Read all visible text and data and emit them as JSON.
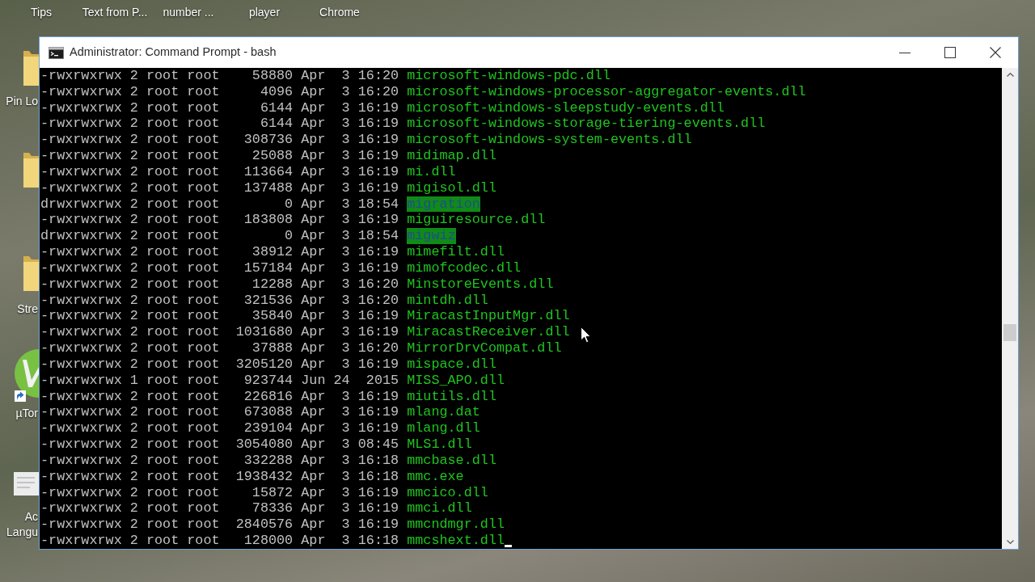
{
  "desktop": {
    "top_labels": [
      "Tips",
      "Text from P...",
      "number ...",
      "player",
      "Chrome"
    ],
    "side_icons": [
      {
        "kind": "folder",
        "label_lines": [
          "Pin Lo"
        ]
      },
      {
        "kind": "folder"
      },
      {
        "kind": "folder",
        "label_lines": [
          "Stre"
        ]
      },
      {
        "kind": "app",
        "label_lines": [
          "µTor"
        ]
      },
      {
        "kind": "document",
        "label_lines": [
          "Ac",
          "Langu"
        ]
      }
    ]
  },
  "window": {
    "title": "Administrator: Command Prompt - bash"
  },
  "terminal": {
    "cursor": true,
    "lines": [
      {
        "kind": "file",
        "info": "-rwxrwxrwx 2 root root    58880 Apr  3 16:20",
        "name": "microsoft-windows-pdc.dll"
      },
      {
        "kind": "file",
        "info": "-rwxrwxrwx 2 root root     4096 Apr  3 16:20",
        "name": "microsoft-windows-processor-aggregator-events.dll"
      },
      {
        "kind": "file",
        "info": "-rwxrwxrwx 2 root root     6144 Apr  3 16:19",
        "name": "microsoft-windows-sleepstudy-events.dll"
      },
      {
        "kind": "file",
        "info": "-rwxrwxrwx 2 root root     6144 Apr  3 16:19",
        "name": "microsoft-windows-storage-tiering-events.dll"
      },
      {
        "kind": "file",
        "info": "-rwxrwxrwx 2 root root   308736 Apr  3 16:19",
        "name": "microsoft-windows-system-events.dll"
      },
      {
        "kind": "file",
        "info": "-rwxrwxrwx 2 root root    25088 Apr  3 16:19",
        "name": "midimap.dll"
      },
      {
        "kind": "file",
        "info": "-rwxrwxrwx 2 root root   113664 Apr  3 16:19",
        "name": "mi.dll"
      },
      {
        "kind": "file",
        "info": "-rwxrwxrwx 2 root root   137488 Apr  3 16:19",
        "name": "migisol.dll"
      },
      {
        "kind": "directory",
        "info": "drwxrwxrwx 2 root root        0 Apr  3 18:54",
        "name": "migration"
      },
      {
        "kind": "file",
        "info": "-rwxrwxrwx 2 root root   183808 Apr  3 16:19",
        "name": "miguiresource.dll"
      },
      {
        "kind": "directory",
        "info": "drwxrwxrwx 2 root root        0 Apr  3 18:54",
        "name": "migwiz"
      },
      {
        "kind": "file",
        "info": "-rwxrwxrwx 2 root root    38912 Apr  3 16:19",
        "name": "mimefilt.dll"
      },
      {
        "kind": "file",
        "info": "-rwxrwxrwx 2 root root   157184 Apr  3 16:19",
        "name": "mimofcodec.dll"
      },
      {
        "kind": "file",
        "info": "-rwxrwxrwx 2 root root    12288 Apr  3 16:20",
        "name": "MinstoreEvents.dll"
      },
      {
        "kind": "file",
        "info": "-rwxrwxrwx 2 root root   321536 Apr  3 16:20",
        "name": "mintdh.dll"
      },
      {
        "kind": "file",
        "info": "-rwxrwxrwx 2 root root    35840 Apr  3 16:19",
        "name": "MiracastInputMgr.dll"
      },
      {
        "kind": "file",
        "info": "-rwxrwxrwx 2 root root  1031680 Apr  3 16:19",
        "name": "MiracastReceiver.dll"
      },
      {
        "kind": "file",
        "info": "-rwxrwxrwx 2 root root    37888 Apr  3 16:20",
        "name": "MirrorDrvCompat.dll"
      },
      {
        "kind": "file",
        "info": "-rwxrwxrwx 2 root root  3205120 Apr  3 16:19",
        "name": "mispace.dll"
      },
      {
        "kind": "file",
        "info": "-rwxrwxrwx 1 root root   923744 Jun 24  2015",
        "name": "MISS_APO.dll"
      },
      {
        "kind": "file",
        "info": "-rwxrwxrwx 2 root root   226816 Apr  3 16:19",
        "name": "miutils.dll"
      },
      {
        "kind": "file",
        "info": "-rwxrwxrwx 2 root root   673088 Apr  3 16:19",
        "name": "mlang.dat"
      },
      {
        "kind": "file",
        "info": "-rwxrwxrwx 2 root root   239104 Apr  3 16:19",
        "name": "mlang.dll"
      },
      {
        "kind": "file",
        "info": "-rwxrwxrwx 2 root root  3054080 Apr  3 08:45",
        "name": "MLS1.dll"
      },
      {
        "kind": "file",
        "info": "-rwxrwxrwx 2 root root   332288 Apr  3 16:18",
        "name": "mmcbase.dll"
      },
      {
        "kind": "file",
        "info": "-rwxrwxrwx 2 root root  1938432 Apr  3 16:18",
        "name": "mmc.exe"
      },
      {
        "kind": "file",
        "info": "-rwxrwxrwx 2 root root    15872 Apr  3 16:19",
        "name": "mmcico.dll"
      },
      {
        "kind": "file",
        "info": "-rwxrwxrwx 2 root root    78336 Apr  3 16:19",
        "name": "mmci.dll"
      },
      {
        "kind": "file",
        "info": "-rwxrwxrwx 2 root root  2840576 Apr  3 16:19",
        "name": "mmcndmgr.dll"
      },
      {
        "kind": "file",
        "info": "-rwxrwxrwx 2 root root   128000 Apr  3 16:18",
        "name": "mmcshext.dll"
      }
    ]
  }
}
